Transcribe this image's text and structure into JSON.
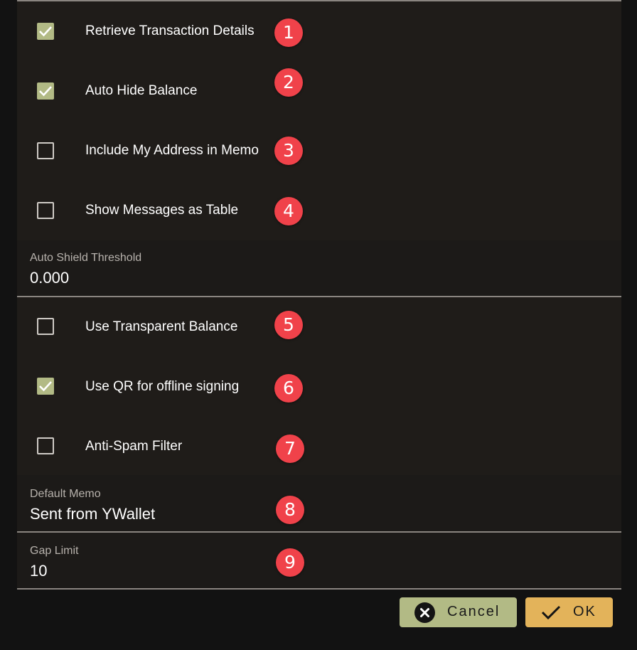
{
  "settings": {
    "checkboxes": [
      {
        "label": "Retrieve Transaction Details",
        "checked": true,
        "badge": "1"
      },
      {
        "label": "Auto Hide Balance",
        "checked": true,
        "badge": "2"
      },
      {
        "label": "Include My Address in Memo",
        "checked": false,
        "badge": "3"
      },
      {
        "label": "Show Messages as Table",
        "checked": false,
        "badge": "4"
      },
      {
        "label": "Use Transparent Balance",
        "checked": false,
        "badge": "5"
      },
      {
        "label": "Use QR for offline signing",
        "checked": true,
        "badge": "6"
      },
      {
        "label": "Anti-Spam Filter",
        "checked": false,
        "badge": "7"
      }
    ],
    "auto_shield": {
      "label": "Auto Shield Threshold",
      "value": "0.000"
    },
    "default_memo": {
      "label": "Default Memo",
      "value": "Sent from YWallet",
      "badge": "8"
    },
    "gap_limit": {
      "label": "Gap Limit",
      "value": "10",
      "badge": "9"
    }
  },
  "buttons": {
    "cancel": {
      "label": "Cancel",
      "icon": "close-circle-icon",
      "color": "#b2ba85"
    },
    "ok": {
      "label": "OK",
      "icon": "check-icon",
      "color": "#e3b35a"
    }
  },
  "colors": {
    "background": "#121212",
    "panel": "#1f1c19",
    "checkbox_checked": "#b2ba85",
    "badge": "#f0424a"
  }
}
